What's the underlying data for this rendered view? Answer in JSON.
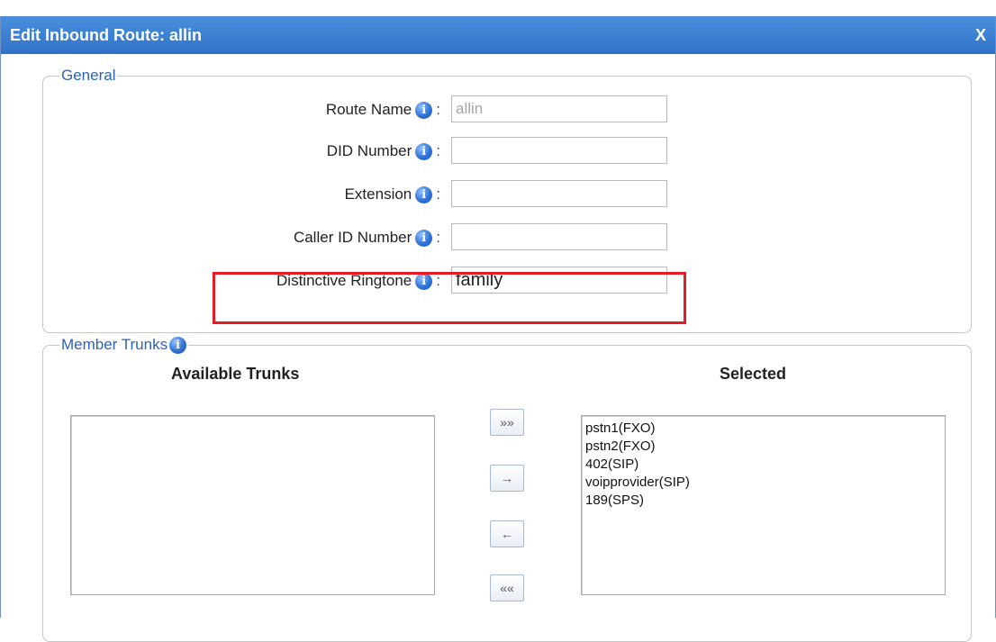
{
  "dialog": {
    "title": "Edit Inbound Route: allin",
    "close_label": "X"
  },
  "general": {
    "legend": "General",
    "fields": [
      {
        "label": "Route Name",
        "value": "allin"
      },
      {
        "label": "DID Number",
        "value": ""
      },
      {
        "label": "Extension",
        "value": ""
      },
      {
        "label": "Caller ID Number",
        "value": ""
      },
      {
        "label": "Distinctive Ringtone",
        "value": "family"
      }
    ]
  },
  "trunks": {
    "legend": "Member Trunks",
    "available_heading": "Available Trunks",
    "selected_heading": "Selected",
    "available_items": [],
    "selected_items": [
      "pstn1(FXO)",
      "pstn2(FXO)",
      "402(SIP)",
      "voipprovider(SIP)",
      "189(SPS)"
    ],
    "buttons": {
      "add_all": "»»",
      "add_one": "→",
      "remove_one": "←",
      "remove_all": "««"
    }
  },
  "colors": {
    "title_bar": "#2f73c9",
    "legend_text": "#2c63b8",
    "highlight": "#e51c23"
  },
  "icons": {
    "info": "i"
  }
}
